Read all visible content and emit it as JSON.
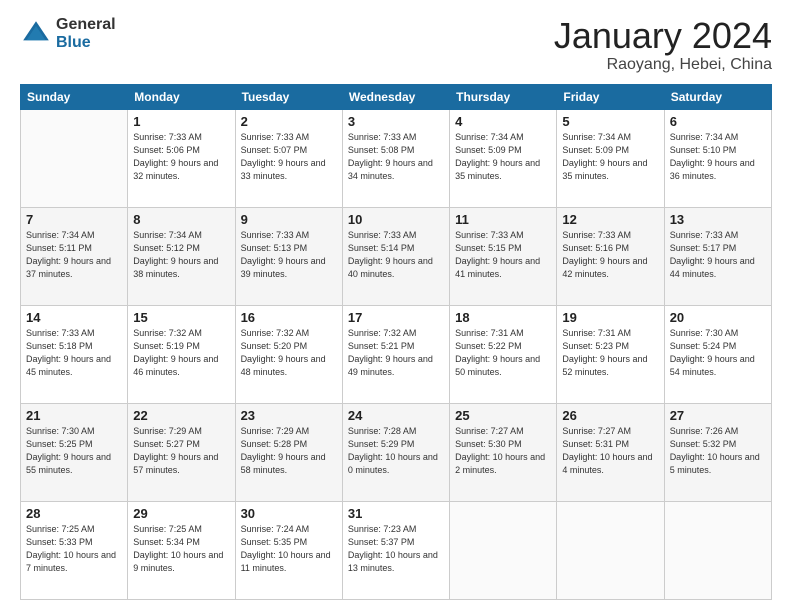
{
  "logo": {
    "general": "General",
    "blue": "Blue"
  },
  "title": "January 2024",
  "location": "Raoyang, Hebei, China",
  "days_of_week": [
    "Sunday",
    "Monday",
    "Tuesday",
    "Wednesday",
    "Thursday",
    "Friday",
    "Saturday"
  ],
  "weeks": [
    [
      {
        "day": null,
        "sunrise": null,
        "sunset": null,
        "daylight": null
      },
      {
        "day": "1",
        "sunrise": "Sunrise: 7:33 AM",
        "sunset": "Sunset: 5:06 PM",
        "daylight": "Daylight: 9 hours and 32 minutes."
      },
      {
        "day": "2",
        "sunrise": "Sunrise: 7:33 AM",
        "sunset": "Sunset: 5:07 PM",
        "daylight": "Daylight: 9 hours and 33 minutes."
      },
      {
        "day": "3",
        "sunrise": "Sunrise: 7:33 AM",
        "sunset": "Sunset: 5:08 PM",
        "daylight": "Daylight: 9 hours and 34 minutes."
      },
      {
        "day": "4",
        "sunrise": "Sunrise: 7:34 AM",
        "sunset": "Sunset: 5:09 PM",
        "daylight": "Daylight: 9 hours and 35 minutes."
      },
      {
        "day": "5",
        "sunrise": "Sunrise: 7:34 AM",
        "sunset": "Sunset: 5:09 PM",
        "daylight": "Daylight: 9 hours and 35 minutes."
      },
      {
        "day": "6",
        "sunrise": "Sunrise: 7:34 AM",
        "sunset": "Sunset: 5:10 PM",
        "daylight": "Daylight: 9 hours and 36 minutes."
      }
    ],
    [
      {
        "day": "7",
        "sunrise": "Sunrise: 7:34 AM",
        "sunset": "Sunset: 5:11 PM",
        "daylight": "Daylight: 9 hours and 37 minutes."
      },
      {
        "day": "8",
        "sunrise": "Sunrise: 7:34 AM",
        "sunset": "Sunset: 5:12 PM",
        "daylight": "Daylight: 9 hours and 38 minutes."
      },
      {
        "day": "9",
        "sunrise": "Sunrise: 7:33 AM",
        "sunset": "Sunset: 5:13 PM",
        "daylight": "Daylight: 9 hours and 39 minutes."
      },
      {
        "day": "10",
        "sunrise": "Sunrise: 7:33 AM",
        "sunset": "Sunset: 5:14 PM",
        "daylight": "Daylight: 9 hours and 40 minutes."
      },
      {
        "day": "11",
        "sunrise": "Sunrise: 7:33 AM",
        "sunset": "Sunset: 5:15 PM",
        "daylight": "Daylight: 9 hours and 41 minutes."
      },
      {
        "day": "12",
        "sunrise": "Sunrise: 7:33 AM",
        "sunset": "Sunset: 5:16 PM",
        "daylight": "Daylight: 9 hours and 42 minutes."
      },
      {
        "day": "13",
        "sunrise": "Sunrise: 7:33 AM",
        "sunset": "Sunset: 5:17 PM",
        "daylight": "Daylight: 9 hours and 44 minutes."
      }
    ],
    [
      {
        "day": "14",
        "sunrise": "Sunrise: 7:33 AM",
        "sunset": "Sunset: 5:18 PM",
        "daylight": "Daylight: 9 hours and 45 minutes."
      },
      {
        "day": "15",
        "sunrise": "Sunrise: 7:32 AM",
        "sunset": "Sunset: 5:19 PM",
        "daylight": "Daylight: 9 hours and 46 minutes."
      },
      {
        "day": "16",
        "sunrise": "Sunrise: 7:32 AM",
        "sunset": "Sunset: 5:20 PM",
        "daylight": "Daylight: 9 hours and 48 minutes."
      },
      {
        "day": "17",
        "sunrise": "Sunrise: 7:32 AM",
        "sunset": "Sunset: 5:21 PM",
        "daylight": "Daylight: 9 hours and 49 minutes."
      },
      {
        "day": "18",
        "sunrise": "Sunrise: 7:31 AM",
        "sunset": "Sunset: 5:22 PM",
        "daylight": "Daylight: 9 hours and 50 minutes."
      },
      {
        "day": "19",
        "sunrise": "Sunrise: 7:31 AM",
        "sunset": "Sunset: 5:23 PM",
        "daylight": "Daylight: 9 hours and 52 minutes."
      },
      {
        "day": "20",
        "sunrise": "Sunrise: 7:30 AM",
        "sunset": "Sunset: 5:24 PM",
        "daylight": "Daylight: 9 hours and 54 minutes."
      }
    ],
    [
      {
        "day": "21",
        "sunrise": "Sunrise: 7:30 AM",
        "sunset": "Sunset: 5:25 PM",
        "daylight": "Daylight: 9 hours and 55 minutes."
      },
      {
        "day": "22",
        "sunrise": "Sunrise: 7:29 AM",
        "sunset": "Sunset: 5:27 PM",
        "daylight": "Daylight: 9 hours and 57 minutes."
      },
      {
        "day": "23",
        "sunrise": "Sunrise: 7:29 AM",
        "sunset": "Sunset: 5:28 PM",
        "daylight": "Daylight: 9 hours and 58 minutes."
      },
      {
        "day": "24",
        "sunrise": "Sunrise: 7:28 AM",
        "sunset": "Sunset: 5:29 PM",
        "daylight": "Daylight: 10 hours and 0 minutes."
      },
      {
        "day": "25",
        "sunrise": "Sunrise: 7:27 AM",
        "sunset": "Sunset: 5:30 PM",
        "daylight": "Daylight: 10 hours and 2 minutes."
      },
      {
        "day": "26",
        "sunrise": "Sunrise: 7:27 AM",
        "sunset": "Sunset: 5:31 PM",
        "daylight": "Daylight: 10 hours and 4 minutes."
      },
      {
        "day": "27",
        "sunrise": "Sunrise: 7:26 AM",
        "sunset": "Sunset: 5:32 PM",
        "daylight": "Daylight: 10 hours and 5 minutes."
      }
    ],
    [
      {
        "day": "28",
        "sunrise": "Sunrise: 7:25 AM",
        "sunset": "Sunset: 5:33 PM",
        "daylight": "Daylight: 10 hours and 7 minutes."
      },
      {
        "day": "29",
        "sunrise": "Sunrise: 7:25 AM",
        "sunset": "Sunset: 5:34 PM",
        "daylight": "Daylight: 10 hours and 9 minutes."
      },
      {
        "day": "30",
        "sunrise": "Sunrise: 7:24 AM",
        "sunset": "Sunset: 5:35 PM",
        "daylight": "Daylight: 10 hours and 11 minutes."
      },
      {
        "day": "31",
        "sunrise": "Sunrise: 7:23 AM",
        "sunset": "Sunset: 5:37 PM",
        "daylight": "Daylight: 10 hours and 13 minutes."
      },
      {
        "day": null,
        "sunrise": null,
        "sunset": null,
        "daylight": null
      },
      {
        "day": null,
        "sunrise": null,
        "sunset": null,
        "daylight": null
      },
      {
        "day": null,
        "sunrise": null,
        "sunset": null,
        "daylight": null
      }
    ]
  ]
}
